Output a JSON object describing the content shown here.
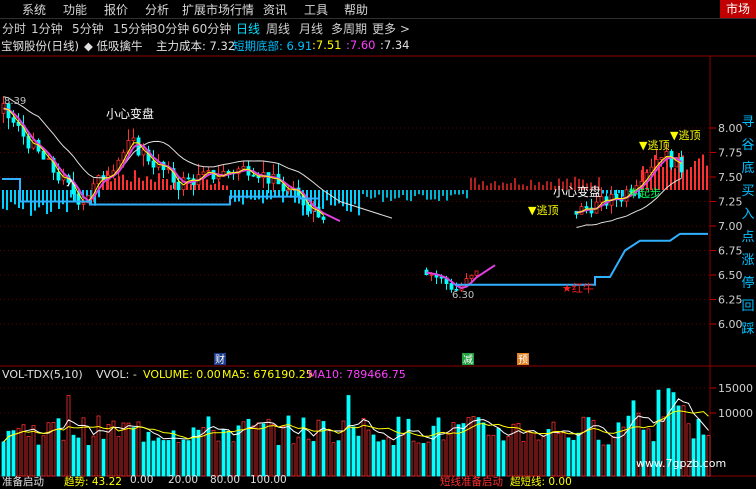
{
  "menu": {
    "items": [
      "系统",
      "功能",
      "报价",
      "分析",
      "扩展市场行情",
      "资讯",
      "工具",
      "帮助"
    ],
    "market": "市场"
  },
  "timeframes": {
    "items": [
      "分时",
      "1分钟",
      "5分钟",
      "15分钟",
      "30分钟",
      "60分钟",
      "日线",
      "周线",
      "月线",
      "多周期",
      "更多 >"
    ],
    "active": "日线"
  },
  "stock_info": {
    "name": "宝钢股份(日线)",
    "indicator": "◆ 低吸擒牛",
    "cost_label": "主力成本: 7.32",
    "bottom_label": "短期底部: 6.91",
    "v1": "7.51",
    "v2": "7.60",
    "v3": "7.34"
  },
  "annotations": {
    "caution1": "小心变盘",
    "caution2": "小心变盘",
    "high_mark": "8.39",
    "low_mark": "6.30",
    "escape1": "▼逃顶",
    "escape2": "▼逃顶",
    "escape3": "▼逃顶",
    "bull_start": "牛起步",
    "red_bull": "★红牛",
    "enter": "入",
    "cai": "财",
    "jian": "减",
    "yu": "预",
    "side_text": "寻谷底买入点涨停回踩"
  },
  "price_axis": {
    "ticks": [
      "8.00",
      "7.75",
      "7.50",
      "7.25",
      "7.00",
      "6.75",
      "6.50",
      "6.25",
      "6.00"
    ],
    "values": [
      8.0,
      7.75,
      7.5,
      7.25,
      7.0,
      6.75,
      6.5,
      6.25,
      6.0
    ]
  },
  "volume_info": {
    "name": "VOL-TDX(5,10)",
    "vvol": "VVOL: -",
    "volume": "VOLUME: 0.00",
    "ma5": "MA5: 676190.25",
    "ma10": "MA10: 789466.75"
  },
  "volume_axis": {
    "ticks": [
      "15000",
      "10000"
    ],
    "values": [
      15000,
      10000
    ]
  },
  "status": {
    "left": "准备启动",
    "trend_label": "趋势: 43.22",
    "v1": "0.00",
    "v2": "20.00",
    "v3": "80.00",
    "v4": "100.00",
    "right1": "短线准备启动",
    "right2": "超短线: 0.00"
  },
  "watermark": "www.7gpzb.com",
  "colors": {
    "accent": "#00e0ff",
    "up": "#ff3030",
    "down": "#00ffff",
    "ma_magenta": "#e040e0",
    "ma_white": "#e0e0e0",
    "cost_line": "#30b0ff",
    "yellow": "#ffff00"
  },
  "chart_data": [
    {
      "type": "candlestick",
      "title": "宝钢股份(日线)",
      "y_axis_ticks": [
        8.0,
        7.75,
        7.5,
        7.25,
        7.0,
        6.75,
        6.5,
        6.25,
        6.0
      ],
      "ylim": [
        5.9,
        8.45
      ],
      "annotated_values": {
        "high": 8.39,
        "low": 6.3
      },
      "series": [
        {
          "name": "主力成本",
          "value": 7.32
        },
        {
          "name": "短期底部",
          "value": 6.91
        }
      ]
    },
    {
      "type": "bar",
      "title": "VOL-TDX(5,10)",
      "y_axis_ticks": [
        15000,
        10000
      ],
      "series": [
        {
          "name": "MA5",
          "value": 676190.25
        },
        {
          "name": "MA10",
          "value": 789466.75
        }
      ]
    }
  ]
}
